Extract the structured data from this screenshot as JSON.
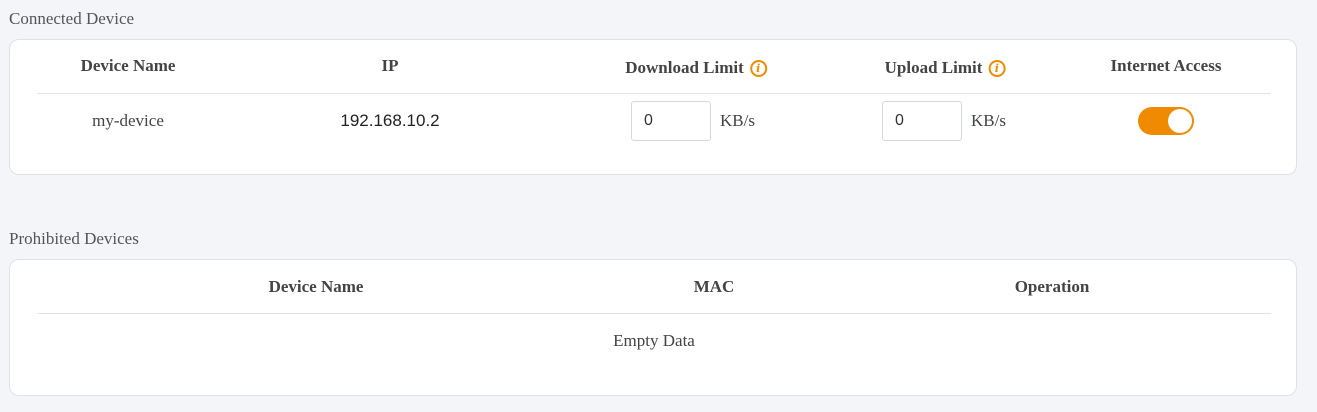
{
  "connected": {
    "section_title": "Connected Device",
    "headers": {
      "device_name": "Device Name",
      "ip": "IP",
      "download_limit": "Download Limit",
      "upload_limit": "Upload Limit",
      "internet_access": "Internet Access"
    },
    "rows": [
      {
        "device_name": "my-device",
        "ip": "192.168.10.2",
        "download_limit": "0",
        "download_unit": "KB/s",
        "upload_limit": "0",
        "upload_unit": "KB/s",
        "internet_access": true
      }
    ]
  },
  "prohibited": {
    "section_title": "Prohibited Devices",
    "headers": {
      "device_name": "Device Name",
      "mac": "MAC",
      "operation": "Operation"
    },
    "empty_text": "Empty Data"
  },
  "icons": {
    "download_info": "info-icon",
    "upload_info": "info-icon"
  },
  "colors": {
    "accent": "#f08a00",
    "background": "#f4f5f8",
    "card": "#ffffff"
  }
}
